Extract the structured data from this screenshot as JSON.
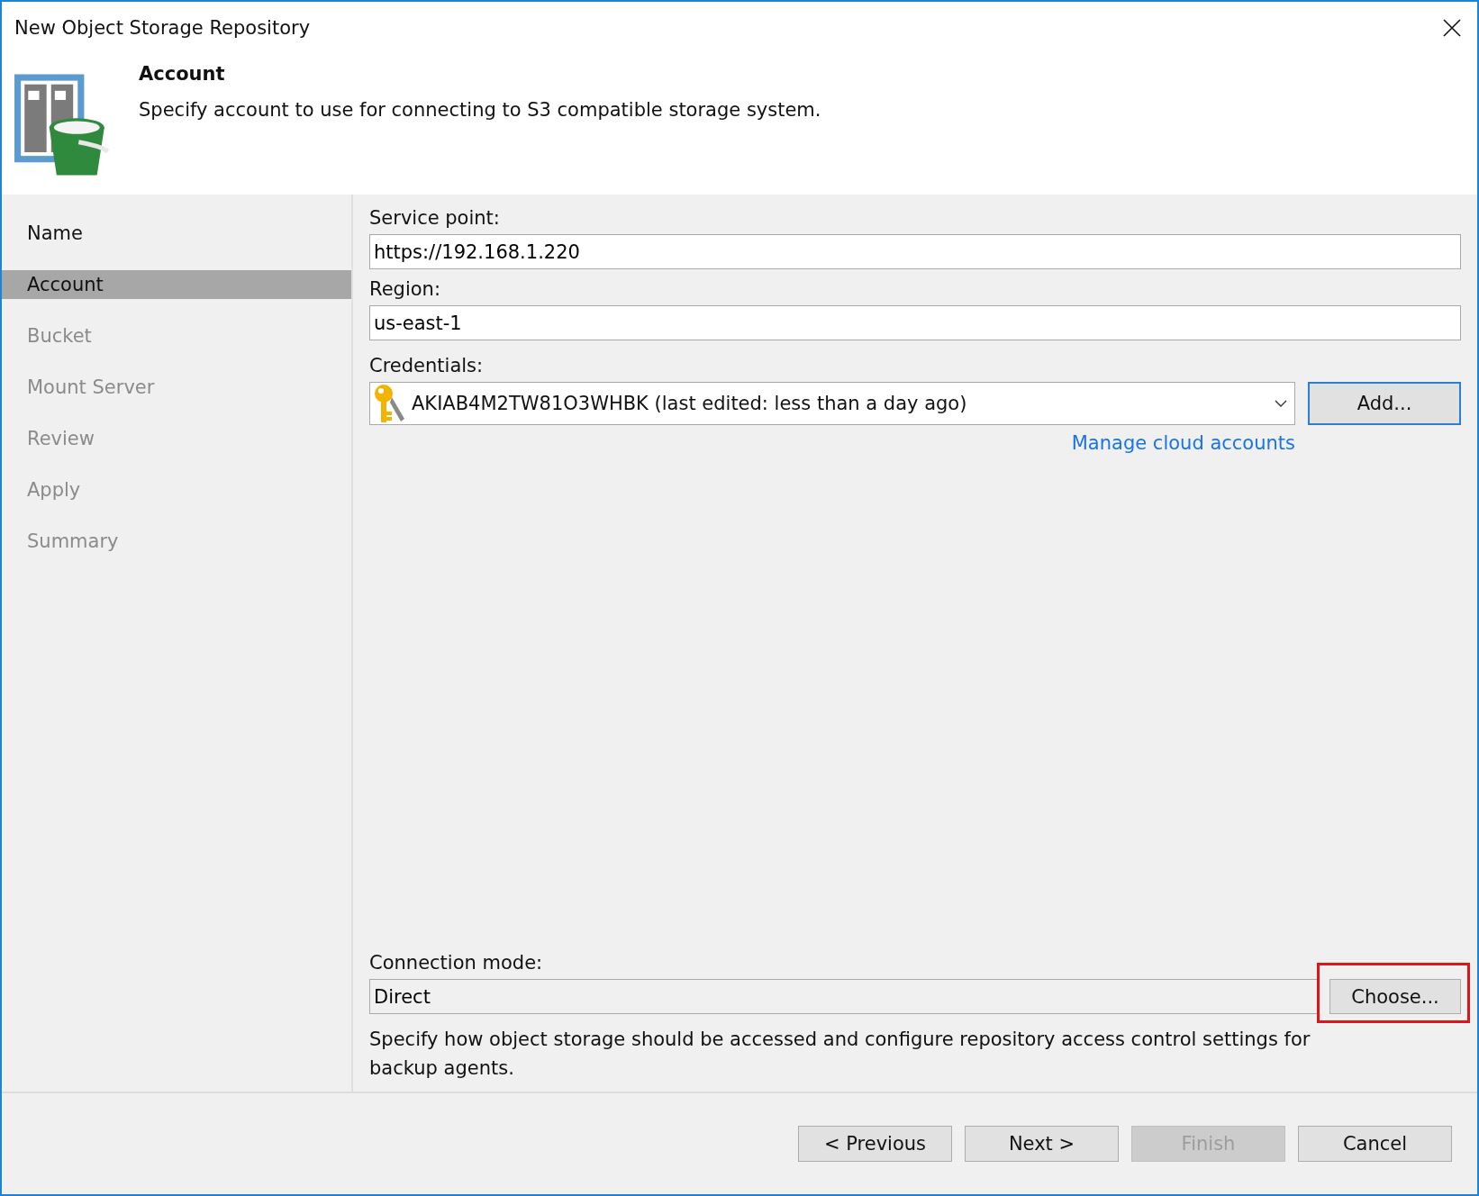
{
  "window": {
    "title": "New Object Storage Repository"
  },
  "header": {
    "title": "Account",
    "description": "Specify account to use for connecting to S3 compatible storage system."
  },
  "steps": [
    {
      "label": "Name",
      "selected": false,
      "disabled": false
    },
    {
      "label": "Account",
      "selected": true,
      "disabled": false
    },
    {
      "label": "Bucket",
      "selected": false,
      "disabled": true
    },
    {
      "label": "Mount Server",
      "selected": false,
      "disabled": true
    },
    {
      "label": "Review",
      "selected": false,
      "disabled": true
    },
    {
      "label": "Apply",
      "selected": false,
      "disabled": true
    },
    {
      "label": "Summary",
      "selected": false,
      "disabled": true
    }
  ],
  "form": {
    "service_point": {
      "label": "Service point:",
      "value": "https://192.168.1.220"
    },
    "region": {
      "label": "Region:",
      "value": "us-east-1"
    },
    "credentials": {
      "label": "Credentials:",
      "value": "AKIAB4M2TW81O3WHBK (last edited: less than a day ago)",
      "add_button": "Add...",
      "link": "Manage cloud accounts"
    },
    "connection_mode": {
      "label": "Connection mode:",
      "value": "Direct",
      "button": "Choose...",
      "highlighted": true,
      "description": "Specify how object storage should be accessed and configure repository access control settings for backup agents."
    }
  },
  "buttons": [
    {
      "label": "< Previous",
      "disabled": false
    },
    {
      "label": "Next >",
      "disabled": false
    },
    {
      "label": "Finish",
      "disabled": true
    },
    {
      "label": "Cancel",
      "disabled": false
    }
  ]
}
